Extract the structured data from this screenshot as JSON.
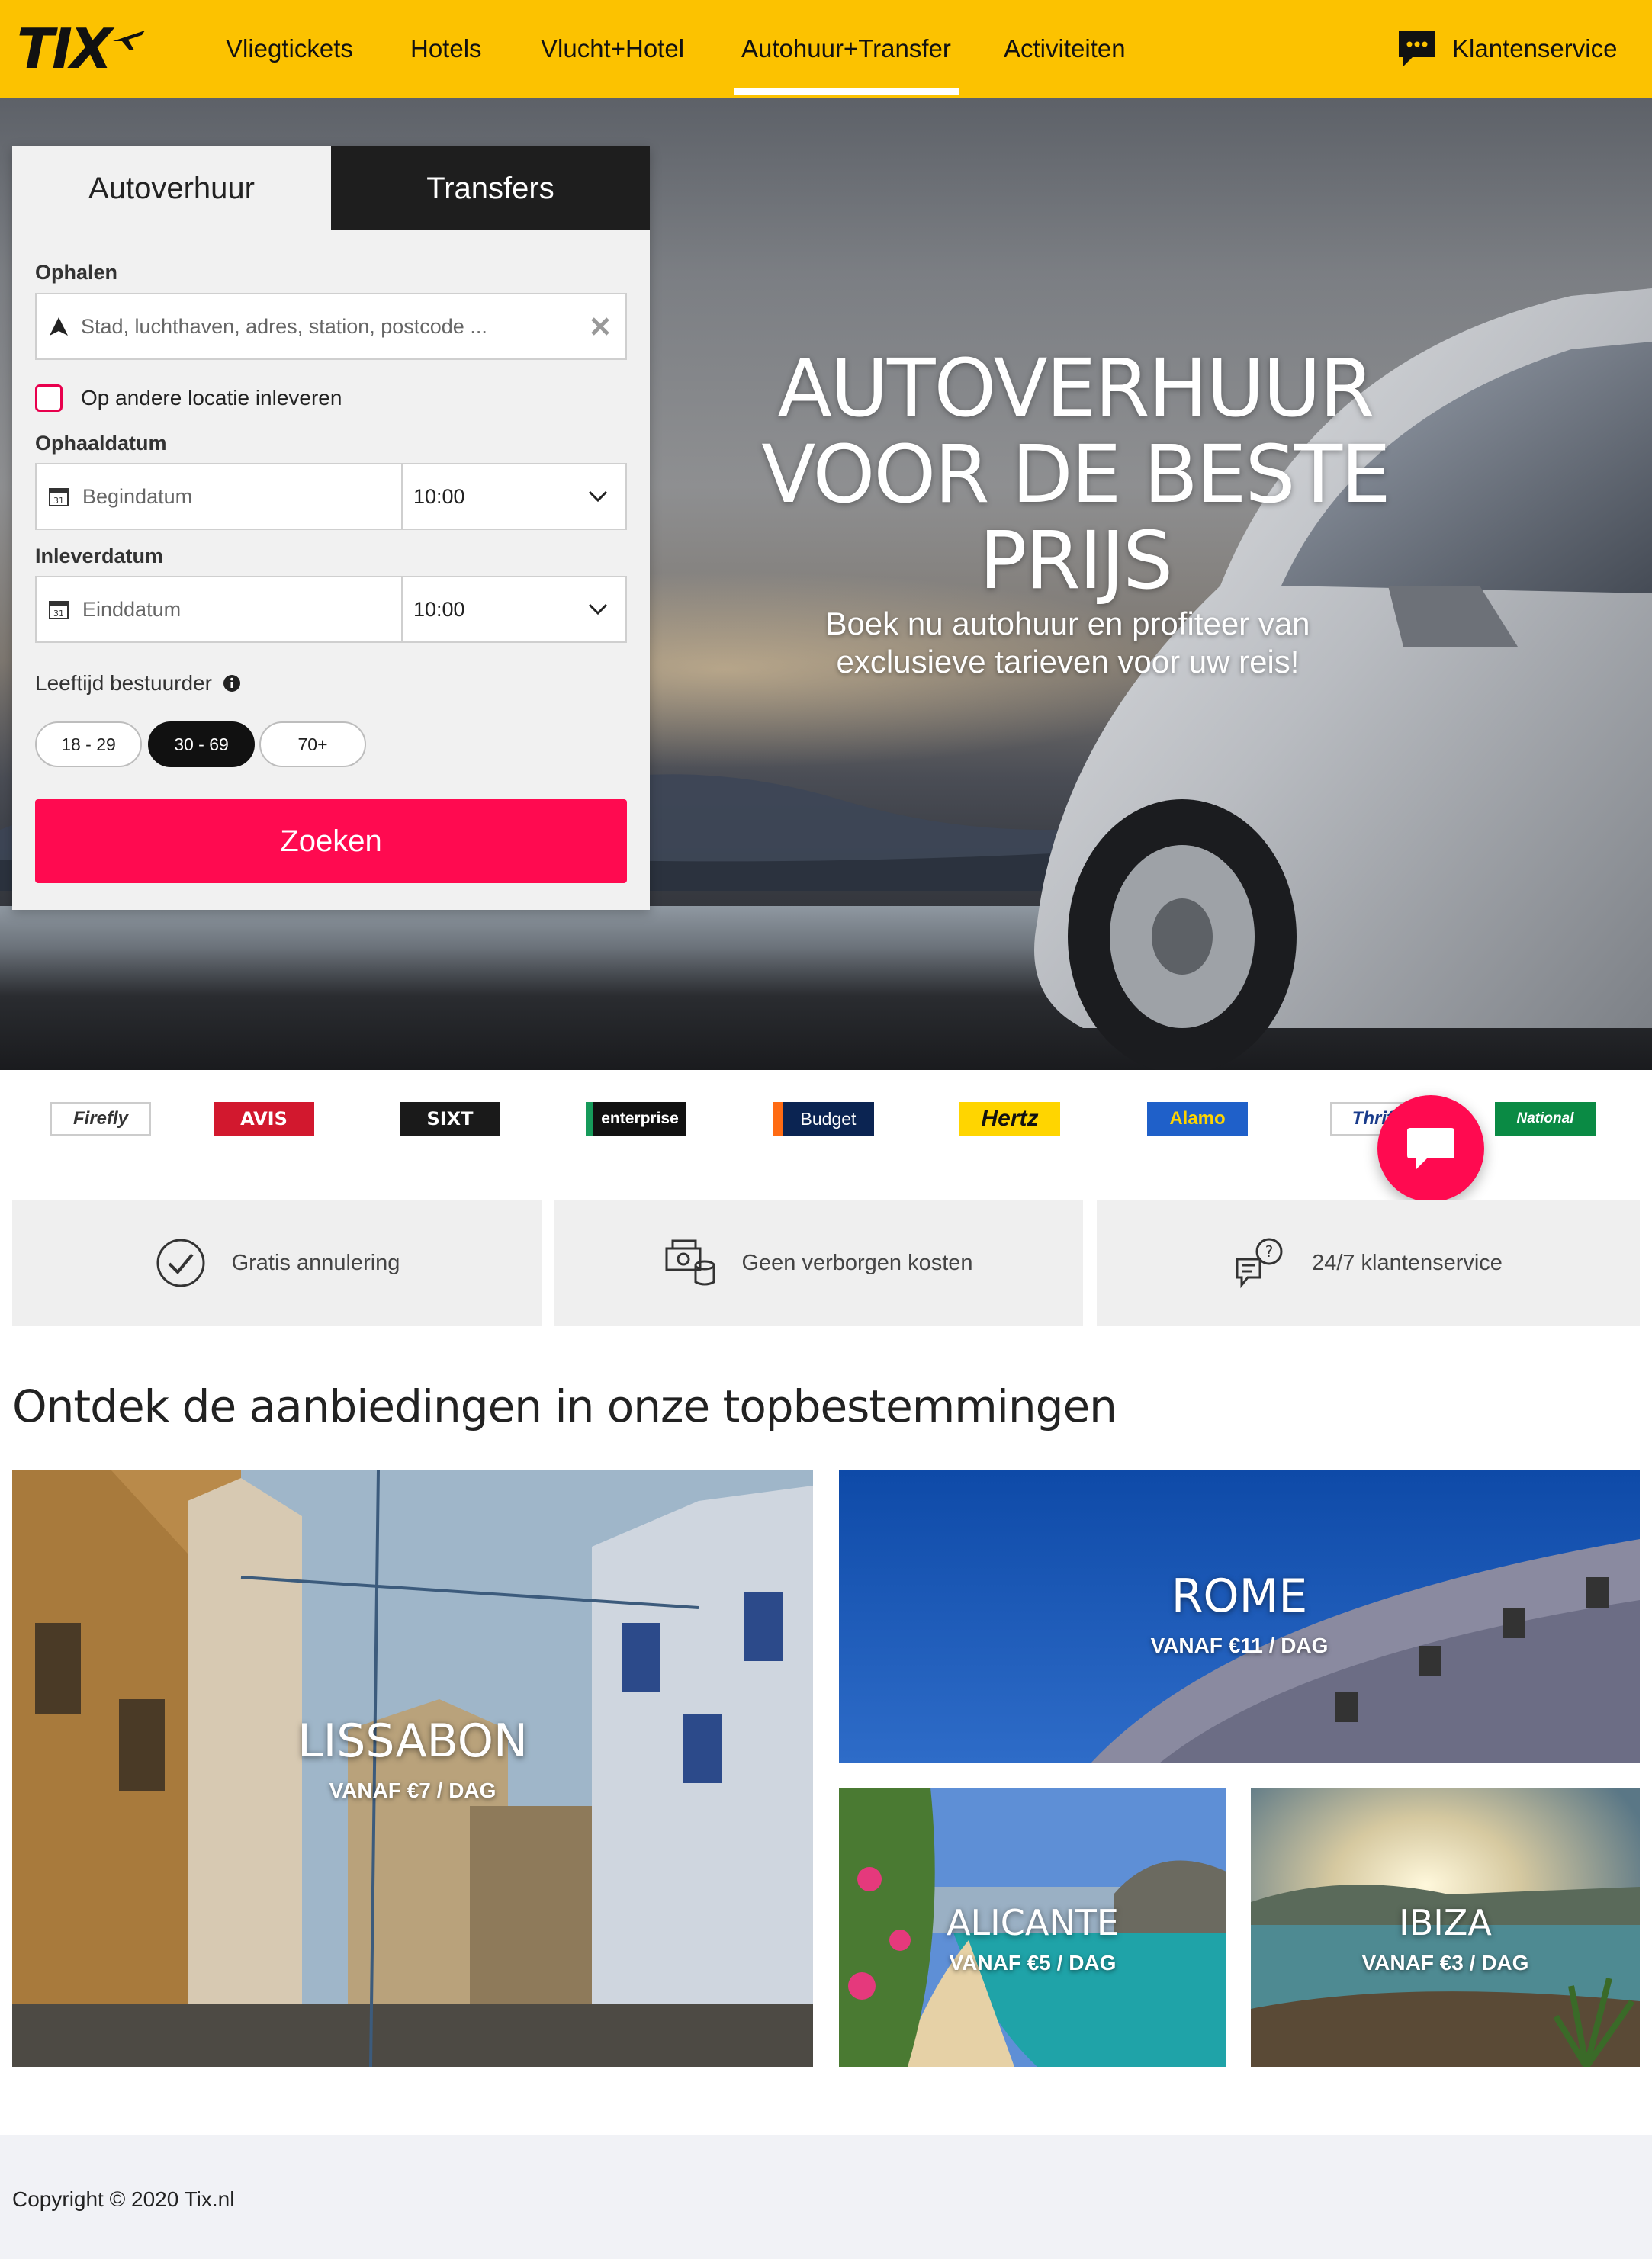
{
  "brand": {
    "logo": "TIX",
    "accent": "#fcc200",
    "cta": "#ff0a50"
  },
  "nav": {
    "items": [
      "Vliegtickets",
      "Hotels",
      "Vlucht+Hotel",
      "Autohuur+Transfer",
      "Activiteiten"
    ],
    "active": "Autohuur+Transfer",
    "service": "Klantenservice"
  },
  "hero": {
    "title": "AUTOVERHUUR VOOR DE BESTE PRIJS",
    "subtitle": "Boek nu autohuur en profiteer van exclusieve tarieven voor uw reis!"
  },
  "search": {
    "tabs": [
      "Autoverhuur",
      "Transfers"
    ],
    "pickup_label": "Ophalen",
    "pickup_placeholder": "Stad, luchthaven, adres, station, postcode ...",
    "dropoff_check": "Op andere locatie inleveren",
    "pickup_date_label": "Ophaaldatum",
    "pickup_date_placeholder": "Begindatum",
    "pickup_time": "10:00",
    "return_date_label": "Inleverdatum",
    "return_date_placeholder": "Einddatum",
    "return_time": "10:00",
    "calendar_day": "31",
    "age_label": "Leeftijd bestuurder",
    "ages": [
      "18 - 29",
      "30 - 69",
      "70+"
    ],
    "age_selected": "30 - 69",
    "submit": "Zoeken"
  },
  "partners": [
    "Firefly",
    "AVIS",
    "SIXT",
    "enterprise",
    "Budget",
    "Hertz",
    "Alamo",
    "Thrifty",
    "National"
  ],
  "usps": [
    "Gratis annulering",
    "Geen verborgen kosten",
    "24/7 klantenservice"
  ],
  "destinations": {
    "title": "Ontdek de aanbiedingen in onze topbestemmingen",
    "items": [
      {
        "name": "LISSABON",
        "price": "VANAF €7 / DAG"
      },
      {
        "name": "ROME",
        "price": "VANAF €11 / DAG"
      },
      {
        "name": "ALICANTE",
        "price": "VANAF €5 / DAG"
      },
      {
        "name": "IBIZA",
        "price": "VANAF €3 / DAG"
      }
    ]
  },
  "footer": {
    "copyright": "Copyright © 2020 Tix.nl"
  }
}
